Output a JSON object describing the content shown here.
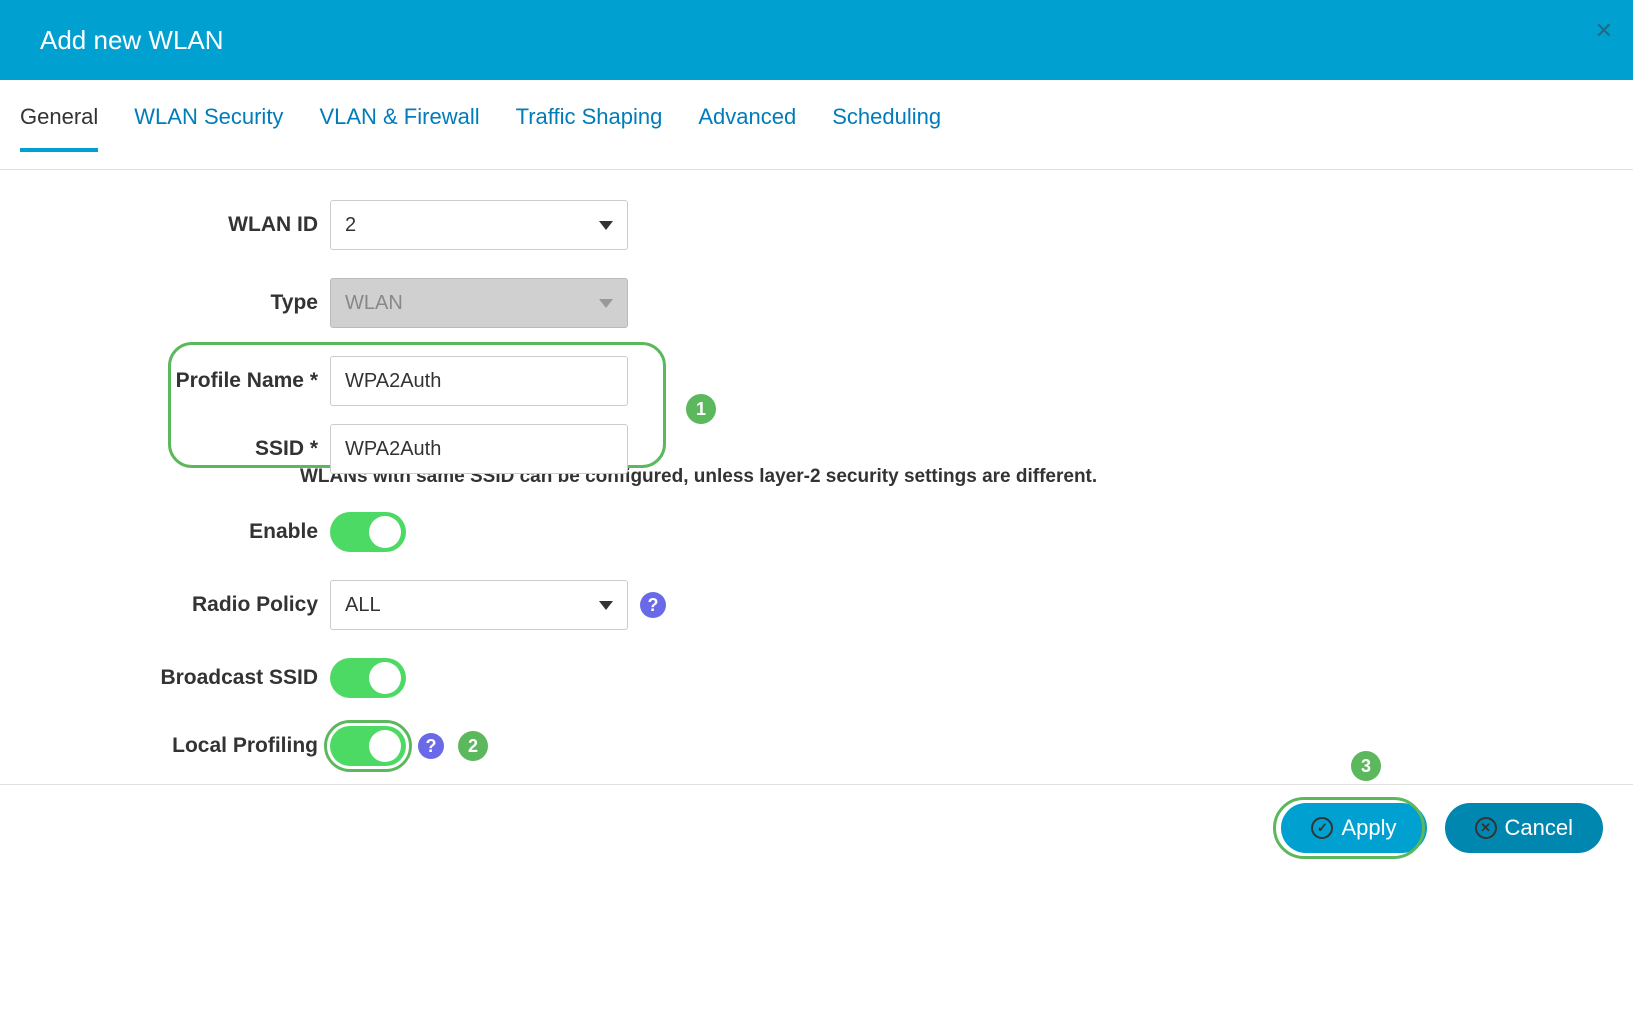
{
  "header": {
    "title": "Add new WLAN"
  },
  "tabs": {
    "items": [
      {
        "label": "General",
        "active": true
      },
      {
        "label": "WLAN Security",
        "active": false
      },
      {
        "label": "VLAN & Firewall",
        "active": false
      },
      {
        "label": "Traffic Shaping",
        "active": false
      },
      {
        "label": "Advanced",
        "active": false
      },
      {
        "label": "Scheduling",
        "active": false
      }
    ]
  },
  "form": {
    "wlan_id": {
      "label": "WLAN ID",
      "value": "2"
    },
    "type": {
      "label": "Type",
      "value": "WLAN"
    },
    "profile_name": {
      "label": "Profile Name *",
      "value": "WPA2Auth"
    },
    "ssid": {
      "label": "SSID *",
      "value": "WPA2Auth",
      "helper": "WLANs with same SSID can be configured, unless layer-2 security settings are different."
    },
    "enable": {
      "label": "Enable",
      "on": true
    },
    "radio_policy": {
      "label": "Radio Policy",
      "value": "ALL"
    },
    "broadcast_ssid": {
      "label": "Broadcast SSID",
      "on": true
    },
    "local_profiling": {
      "label": "Local Profiling",
      "on": true
    }
  },
  "footer": {
    "apply": "Apply",
    "cancel": "Cancel"
  },
  "annotations": {
    "one": "1",
    "two": "2",
    "three": "3"
  },
  "icons": {
    "help": "?",
    "close": "✕",
    "check": "✓",
    "cancel_x": "✕"
  }
}
